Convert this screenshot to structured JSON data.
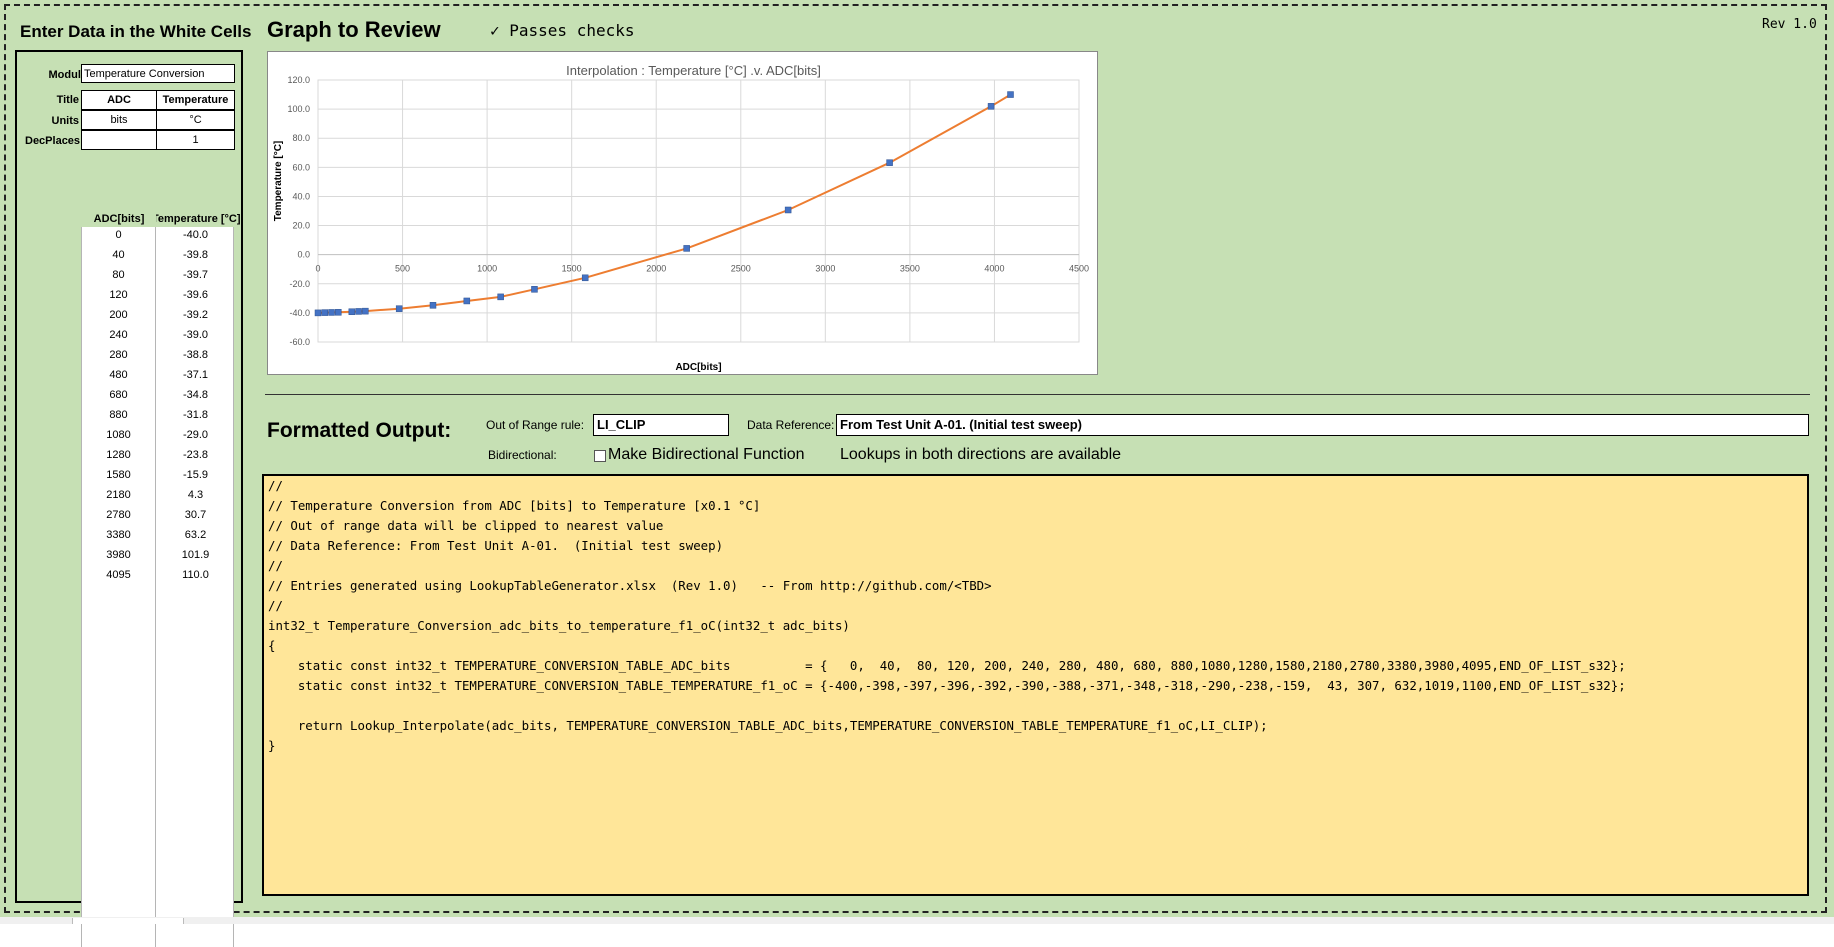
{
  "input_panel": {
    "heading": "Enter Data in the White Cells",
    "module_label": "Module",
    "module_value": "Temperature Conversion",
    "title_label": "Title",
    "units_label": "Units",
    "decplaces_label": "DecPlaces",
    "col_a": {
      "title": "ADC",
      "units": "bits",
      "decplaces": ""
    },
    "col_b": {
      "title": "Temperature",
      "units": "°C",
      "decplaces": "1"
    },
    "data_header_a": "ADC[bits]",
    "data_header_b": "Temperature [°C]",
    "rows": [
      {
        "a": "0",
        "b": "-40.0"
      },
      {
        "a": "40",
        "b": "-39.8"
      },
      {
        "a": "80",
        "b": "-39.7"
      },
      {
        "a": "120",
        "b": "-39.6"
      },
      {
        "a": "200",
        "b": "-39.2"
      },
      {
        "a": "240",
        "b": "-39.0"
      },
      {
        "a": "280",
        "b": "-38.8"
      },
      {
        "a": "480",
        "b": "-37.1"
      },
      {
        "a": "680",
        "b": "-34.8"
      },
      {
        "a": "880",
        "b": "-31.8"
      },
      {
        "a": "1080",
        "b": "-29.0"
      },
      {
        "a": "1280",
        "b": "-23.8"
      },
      {
        "a": "1580",
        "b": "-15.9"
      },
      {
        "a": "2180",
        "b": "4.3"
      },
      {
        "a": "2780",
        "b": "30.7"
      },
      {
        "a": "3380",
        "b": "63.2"
      },
      {
        "a": "3980",
        "b": "101.9"
      },
      {
        "a": "4095",
        "b": "110.0"
      }
    ]
  },
  "graph": {
    "heading": "Graph to Review",
    "status": "✓ Passes checks",
    "rev": "Rev 1.0"
  },
  "chart_data": {
    "type": "line",
    "title": "Interpolation : Temperature [°C] .v. ADC[bits]",
    "xlabel": "ADC[bits]",
    "ylabel": "Temperature [°C]",
    "xlim": [
      0,
      4500
    ],
    "ylim": [
      -60,
      120
    ],
    "x_ticks": [
      "0",
      "500",
      "1000",
      "1500",
      "2000",
      "2500",
      "3000",
      "3500",
      "4000",
      "4500"
    ],
    "y_ticks": [
      "120.0",
      "100.0",
      "80.0",
      "60.0",
      "40.0",
      "20.0",
      "0.0",
      "-20.0",
      "-40.0",
      "-60.0"
    ],
    "grid": true,
    "line_color": "#ed7d31",
    "marker_color": "#4472c4",
    "x": [
      0,
      40,
      80,
      120,
      200,
      240,
      280,
      480,
      680,
      880,
      1080,
      1280,
      1580,
      2180,
      2780,
      3380,
      3980,
      4095
    ],
    "y": [
      -40.0,
      -39.8,
      -39.7,
      -39.6,
      -39.2,
      -39.0,
      -38.8,
      -37.1,
      -34.8,
      -31.8,
      -29.0,
      -23.8,
      -15.9,
      4.3,
      30.7,
      63.2,
      101.9,
      110.0
    ]
  },
  "output": {
    "heading": "Formatted Output:",
    "range_rule_label": "Out of Range rule:",
    "range_rule_value": "LI_CLIP",
    "data_ref_label": "Data Reference:",
    "data_ref_value": "From Test Unit A-01.  (Initial test sweep)",
    "bidir_label": "Bidirectional:",
    "bidir_checkbox_label": "Make Bidirectional Function",
    "bidir_note": "Lookups in both directions are available",
    "code_lines": [
      "//",
      "// Temperature Conversion from ADC [bits] to Temperature [x0.1 °C]",
      "// Out of range data will be clipped to nearest value",
      "// Data Reference: From Test Unit A-01.  (Initial test sweep)",
      "//",
      "// Entries generated using LookupTableGenerator.xlsx  (Rev 1.0)   -- From http://github.com/<TBD>",
      "//",
      "int32_t Temperature_Conversion_adc_bits_to_temperature_f1_oC(int32_t adc_bits)",
      "{",
      "    static const int32_t TEMPERATURE_CONVERSION_TABLE_ADC_bits          = {   0,  40,  80, 120, 200, 240, 280, 480, 680, 880,1080,1280,1580,2180,2780,3380,3980,4095,END_OF_LIST_s32};",
      "    static const int32_t TEMPERATURE_CONVERSION_TABLE_TEMPERATURE_f1_oC = {-400,-398,-397,-396,-392,-390,-388,-371,-348,-318,-290,-238,-159,  43, 307, 632,1019,1100,END_OF_LIST_s32};",
      "",
      "    return Lookup_Interpolate(adc_bits, TEMPERATURE_CONVERSION_TABLE_ADC_bits,TEMPERATURE_CONVERSION_TABLE_TEMPERATURE_f1_oC,LI_CLIP);",
      "}"
    ]
  }
}
